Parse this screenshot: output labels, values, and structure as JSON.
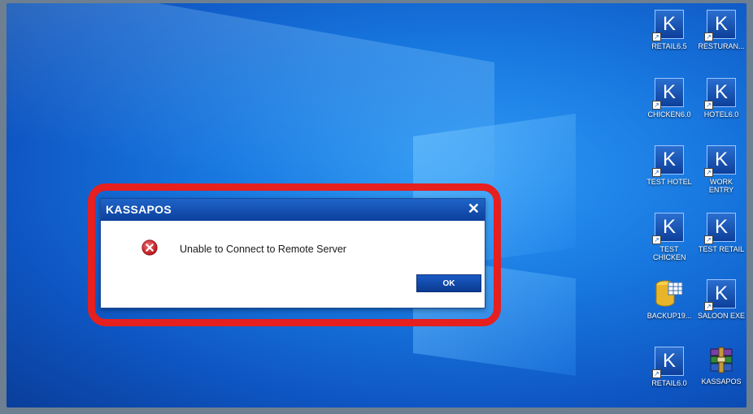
{
  "dialog": {
    "title": "KASSAPOS",
    "message": "Unable to Connect to Remote Server",
    "ok_label": "OK",
    "close_glyph": "✕"
  },
  "desktop_icons": [
    {
      "label": "RETAIL6.5",
      "glyph": "K",
      "icon": "kassapos-shortcut-icon"
    },
    {
      "label": "RESTURAN...",
      "glyph": "K",
      "icon": "kassapos-shortcut-icon"
    },
    {
      "label": "CHICKEN6.0",
      "glyph": "K",
      "icon": "kassapos-shortcut-icon"
    },
    {
      "label": "HOTEL6.0",
      "glyph": "K",
      "icon": "kassapos-shortcut-icon"
    },
    {
      "label": "TEST HOTEL",
      "glyph": "K",
      "icon": "kassapos-shortcut-icon"
    },
    {
      "label": "WORK ENTRY",
      "glyph": "K",
      "icon": "kassapos-shortcut-icon"
    },
    {
      "label": "TEST CHICKEN",
      "glyph": "K",
      "icon": "kassapos-shortcut-icon"
    },
    {
      "label": "TEST RETAIL",
      "glyph": "K",
      "icon": "kassapos-shortcut-icon"
    },
    {
      "label": "BACKUP19...",
      "glyph": "",
      "icon": "database-backup-icon"
    },
    {
      "label": "SALOON EXE",
      "glyph": "K",
      "icon": "kassapos-shortcut-icon"
    },
    {
      "label": "RETAIL6.0",
      "glyph": "K",
      "icon": "kassapos-shortcut-icon"
    },
    {
      "label": "KASSAPOS",
      "glyph": "",
      "icon": "winrar-archive-icon"
    }
  ],
  "colors": {
    "highlight": "#e61f1f",
    "titlebar": "#1e64c8",
    "error": "#d8232a"
  }
}
